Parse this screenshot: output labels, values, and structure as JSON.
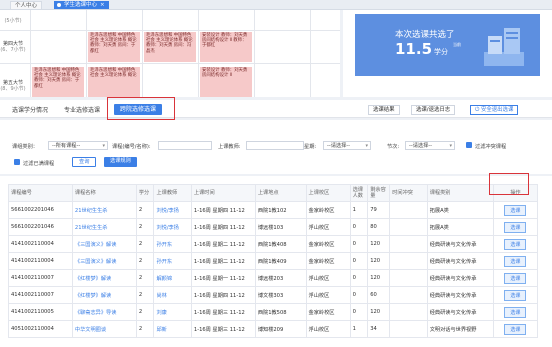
{
  "top_tabs": [
    {
      "label": "个人中心"
    },
    {
      "label": "学生选课中心"
    }
  ],
  "tab_close": "×",
  "schedule": {
    "rows": [
      {
        "name": "",
        "time": "(5小节)"
      },
      {
        "name": "第四大节",
        "time": "(6、7小节)"
      },
      {
        "name": "第五大节",
        "time": "(8、9小节)"
      }
    ],
    "cells": [
      {
        "text": "毛泽东思想和 中国特色社会 主义理论体系 概论 教师：刘天勇 房间：于都红"
      },
      {
        "text": "毛泽东思想和 中国特色社会 主义理论体系 概论 教师：刘天勇 房间：冯晶杰"
      },
      {
        "text": "安装设计 教师：刘天勇 房间结构设计 Ⅱ 教师：于都红"
      },
      {
        "text": "毛泽东思想和 中国特色社会 主义理论体系 概论 教师：刘天勇 房间：于都红"
      },
      {
        "text": "毛泽东思想和 中国特色社会 主义理论体系 概论"
      },
      {
        "text": "安装设计 教师：刘天勇 房间结构设计 Ⅱ"
      }
    ]
  },
  "summary": {
    "line1": "本次选课共选了",
    "credits": "11.5",
    "unit": "学分",
    "note": "当前"
  },
  "subtabs": [
    {
      "label": "选课学分情况"
    },
    {
      "label": "专业选修选课"
    },
    {
      "label": "跨院选修选课"
    }
  ],
  "right_buttons": [
    {
      "label": "选课结果"
    },
    {
      "label": "选课/退选日志"
    },
    {
      "label": "安全退出选课"
    }
  ],
  "filters": {
    "course_type_label": "课组类别：",
    "course_type_value": "--所有课程--",
    "course_name_label": "课程(编号/名称):",
    "course_name_value": "",
    "teacher_label": "上课教师:",
    "teacher_value": "",
    "weekday_label": "星期:",
    "weekday_value": "--请选择--",
    "period_label": "节次:",
    "period_value": "--请选择--",
    "conflict_label": "过滤冲突课程",
    "full_label": "过滤已满课程",
    "query_btn": "查询",
    "rules_btn": "选课规则"
  },
  "table": {
    "headers": [
      "课程编号",
      "课程名称",
      "学分",
      "上课教师",
      "上课时间",
      "上课地点",
      "上课校区",
      "选课人数",
      "剩余容量",
      "时间冲突",
      "课程类别",
      "操作"
    ],
    "rows": [
      [
        "5661002201046",
        "21世纪生生杀",
        "2",
        "刘悦/李扬",
        "1-16周 星期四 11-12",
        "西院1教102",
        "金家岭校区",
        "1",
        "79",
        "",
        "拓展A类",
        "选课"
      ],
      [
        "5661002201046",
        "21世纪生生杀",
        "2",
        "刘悦/李扬",
        "1-16周 星期四 11-12",
        "博远楼103",
        "浮山校区",
        "0",
        "80",
        "",
        "拓展A类",
        "选课"
      ],
      [
        "4141002110004",
        "《三国演义》解读",
        "2",
        "孙开东",
        "1-16周 星期二 11-12",
        "西院1教408",
        "金家岭校区",
        "0",
        "120",
        "",
        "经典研读与文化传承",
        "选课"
      ],
      [
        "4141002110004",
        "《三国演义》解读",
        "2",
        "孙开东",
        "1-16周 星期二 11-12",
        "西院1教409",
        "金家岭校区",
        "0",
        "120",
        "",
        "经典研读与文化传承",
        "选课"
      ],
      [
        "4141002110007",
        "《红楼梦》解读",
        "2",
        "解颜锦",
        "1-16周 星期一 11-12",
        "博远楼203",
        "浮山校区",
        "0",
        "120",
        "",
        "经典研读与文化传承",
        "选课"
      ],
      [
        "4141002110007",
        "《红楼梦》解读",
        "2",
        "尚林",
        "1-16周 星期四 11-12",
        "博文楼303",
        "浮山校区",
        "0",
        "60",
        "",
        "经典研读与文化传承",
        "选课"
      ],
      [
        "4141002110005",
        "《聊斋志异》导读",
        "2",
        "刘康",
        "1-16周 星期三 11-12",
        "西院1教508",
        "金家岭校区",
        "0",
        "120",
        "",
        "经典研读与文化传承",
        "选课"
      ],
      [
        "4051002110004",
        "中华文明圈谈",
        "2",
        "邱新",
        "1-16周 星期三 11-12",
        "博知楼209",
        "浮山校区",
        "1",
        "34",
        "",
        "文明对话与世界视野",
        "选课"
      ]
    ],
    "link_columns": [
      1,
      3
    ]
  },
  "colors": {
    "accent": "#3b7fe6",
    "highlight": "#d9343a",
    "cell": "#f6c9c9"
  }
}
